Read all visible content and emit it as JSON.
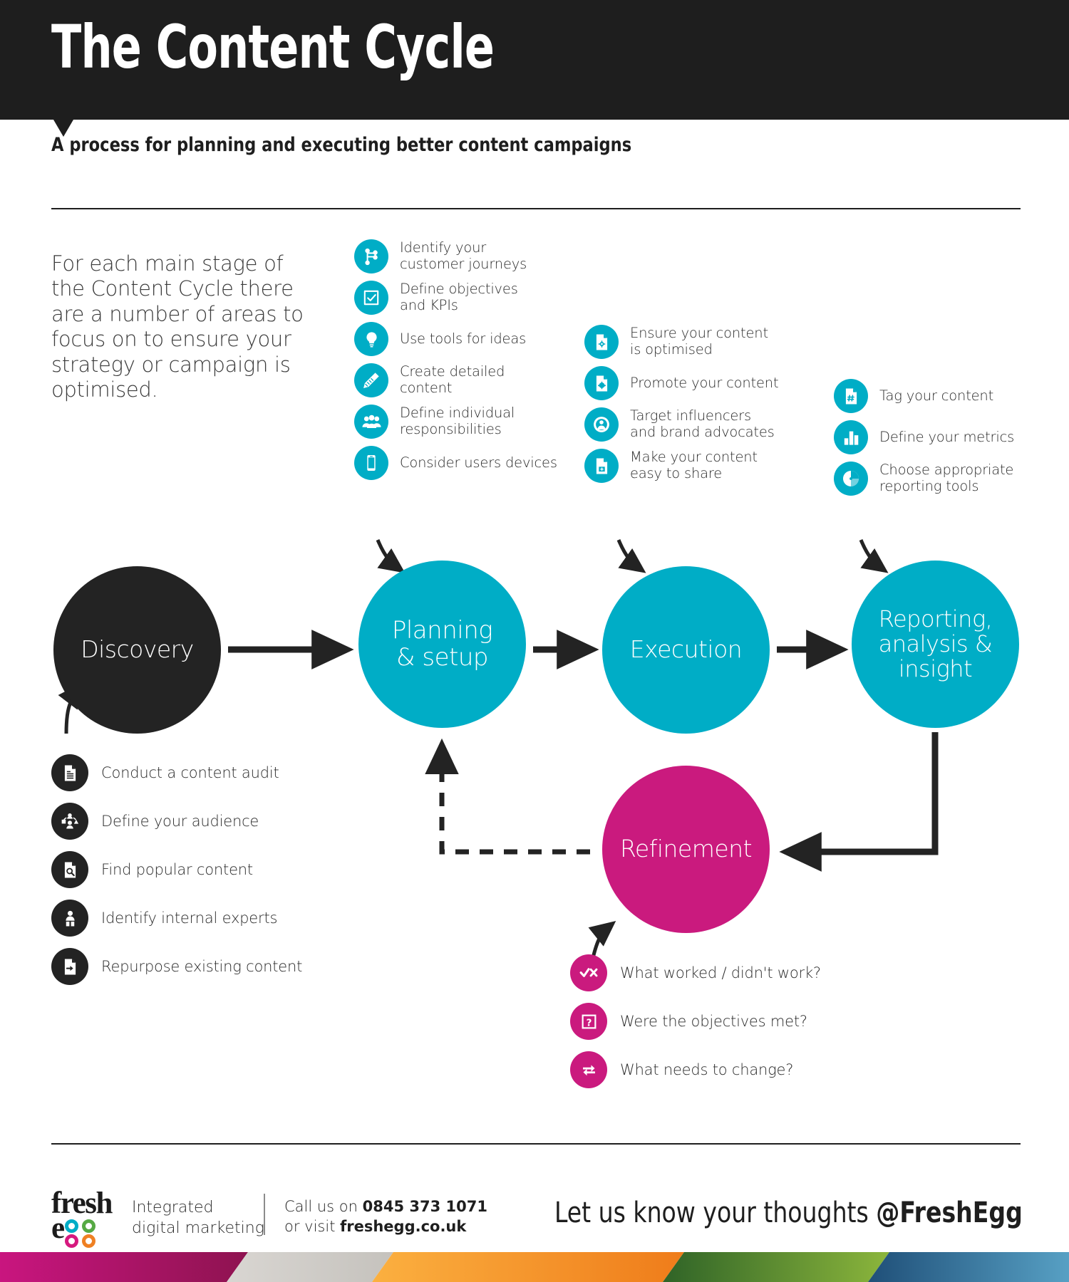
{
  "header": {
    "title": "The Content Cycle",
    "subtitle": "A process for planning and executing better content campaigns"
  },
  "intro": {
    "text": "For each main stage of the Content Cycle there are a number of areas to focus on to ensure your strategy or campaign is optimised."
  },
  "colors": {
    "teal": "#00adc6",
    "dark": "#232323",
    "pink": "#ca1a7e",
    "header_bg": "#1e1e1e"
  },
  "stages": {
    "discovery": {
      "label": "Discovery"
    },
    "planning": {
      "label": "Planning\n& setup"
    },
    "execution": {
      "label": "Execution"
    },
    "reporting": {
      "label": "Reporting,\nanalysis &\ninsight"
    },
    "refinement": {
      "label": "Refinement"
    }
  },
  "lists": {
    "planning": [
      {
        "icon": "journey-map-icon",
        "label": "Identify your\ncustomer journeys"
      },
      {
        "icon": "checkbox-icon",
        "label": "Define objectives\nand KPIs"
      },
      {
        "icon": "lightbulb-icon",
        "label": "Use tools for ideas"
      },
      {
        "icon": "pencil-icon",
        "label": "Create detailed\ncontent"
      },
      {
        "icon": "people-group-icon",
        "label": "Define individual\nresponsibilities"
      },
      {
        "icon": "mobile-device-icon",
        "label": "Consider users devices"
      }
    ],
    "execution": [
      {
        "icon": "document-gear-icon",
        "label": "Ensure your content\nis optimised"
      },
      {
        "icon": "document-badge-icon",
        "label": "Promote your content"
      },
      {
        "icon": "target-person-icon",
        "label": "Target influencers\nand brand advocates"
      },
      {
        "icon": "document-share-icon",
        "label": "Make your content\neasy to share"
      }
    ],
    "reporting": [
      {
        "icon": "document-hash-icon",
        "label": "Tag your content"
      },
      {
        "icon": "bar-chart-icon",
        "label": "Define your metrics"
      },
      {
        "icon": "pie-chart-icon",
        "label": "Choose appropriate\nreporting tools"
      }
    ],
    "discovery": [
      {
        "icon": "document-lines-icon",
        "label": "Conduct a content audit"
      },
      {
        "icon": "audience-network-icon",
        "label": "Define your audience"
      },
      {
        "icon": "document-search-icon",
        "label": "Find popular content"
      },
      {
        "icon": "person-expert-icon",
        "label": "Identify internal experts"
      },
      {
        "icon": "document-repurpose-icon",
        "label": "Repurpose existing content"
      }
    ],
    "refinement": [
      {
        "icon": "check-cross-icon",
        "label": "What worked / didn't work?"
      },
      {
        "icon": "question-box-icon",
        "label": "Were the objectives met?"
      },
      {
        "icon": "swap-arrows-icon",
        "label": "What needs to change?"
      }
    ]
  },
  "footer": {
    "logo_word": "fresh",
    "logo_e": "e",
    "tagline": "Integrated\ndigital marketing",
    "contact_line1_prefix": "Call us on ",
    "contact_phone": "0845 373 1071",
    "contact_line2_prefix": "or visit ",
    "contact_site": "freshegg.co.uk",
    "cta_prefix": "Let us know your thoughts ",
    "cta_handle": "@FreshEgg"
  }
}
